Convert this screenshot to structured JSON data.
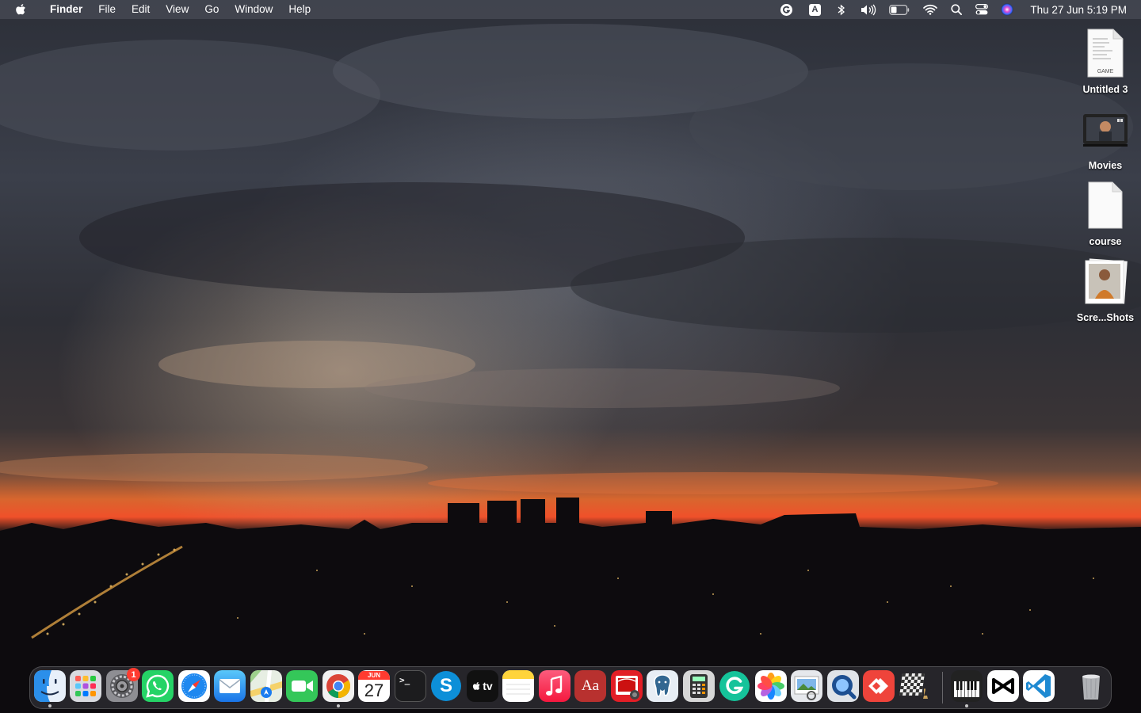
{
  "menubar": {
    "active_app": "Finder",
    "menus": [
      "File",
      "Edit",
      "View",
      "Go",
      "Window",
      "Help"
    ],
    "status_icons": [
      "grammarly-icon",
      "input-source-icon",
      "bluetooth-icon",
      "volume-icon",
      "battery-icon",
      "wifi-icon",
      "spotlight-icon",
      "control-center-icon",
      "siri-icon"
    ],
    "input_source_letter": "A",
    "clock": "Thu 27 Jun  5:19 PM"
  },
  "desktop": {
    "icons": [
      {
        "label": "Untitled 3",
        "icon": "game-document-icon",
        "tag": "GAME"
      },
      {
        "label": "Movies",
        "icon": "movies-folder-icon"
      },
      {
        "label": "course",
        "icon": "document-icon"
      },
      {
        "label": "Scre...Shots",
        "icon": "screenshots-folder-icon"
      }
    ]
  },
  "dock": {
    "apps": [
      {
        "name": "Finder",
        "icon": "finder-icon"
      },
      {
        "name": "Launchpad",
        "icon": "launchpad-icon"
      },
      {
        "name": "System Settings",
        "icon": "system-settings-icon",
        "badge": "1"
      },
      {
        "name": "WhatsApp",
        "icon": "whatsapp-icon"
      },
      {
        "name": "Safari",
        "icon": "safari-icon"
      },
      {
        "name": "Mail",
        "icon": "mail-icon"
      },
      {
        "name": "Maps",
        "icon": "maps-icon"
      },
      {
        "name": "FaceTime",
        "icon": "facetime-icon"
      },
      {
        "name": "Google Chrome",
        "icon": "chrome-icon"
      },
      {
        "name": "Calendar",
        "icon": "calendar-icon",
        "month": "JUN",
        "day": "27"
      },
      {
        "name": "Terminal",
        "icon": "terminal-icon",
        "prompt": ">_"
      },
      {
        "name": "Skype",
        "icon": "skype-icon",
        "letter": "S"
      },
      {
        "name": "TV",
        "icon": "apple-tv-icon",
        "text": "tv"
      },
      {
        "name": "Notes",
        "icon": "notes-icon"
      },
      {
        "name": "Music",
        "icon": "music-icon"
      },
      {
        "name": "Dictionary",
        "icon": "dictionary-icon",
        "text": "Aa"
      },
      {
        "name": "Photo Booth",
        "icon": "photo-booth-icon"
      },
      {
        "name": "PostgreSQL",
        "icon": "postgresql-icon"
      },
      {
        "name": "Calculator",
        "icon": "calculator-icon"
      },
      {
        "name": "Grammarly",
        "icon": "grammarly-app-icon"
      },
      {
        "name": "Photos",
        "icon": "photos-icon"
      },
      {
        "name": "Preview",
        "icon": "preview-icon"
      },
      {
        "name": "QuickTime Player",
        "icon": "quicktime-icon"
      },
      {
        "name": "AnyDesk",
        "icon": "anydesk-icon"
      },
      {
        "name": "Chess",
        "icon": "chess-icon"
      },
      {
        "name": "Piano",
        "icon": "piano-icon"
      },
      {
        "name": "CapCut",
        "icon": "capcut-icon"
      },
      {
        "name": "Visual Studio Code",
        "icon": "vscode-icon"
      },
      {
        "name": "Trash",
        "icon": "trash-icon"
      }
    ],
    "running_indicators": [
      "Finder",
      "Google Chrome",
      "Piano"
    ]
  }
}
